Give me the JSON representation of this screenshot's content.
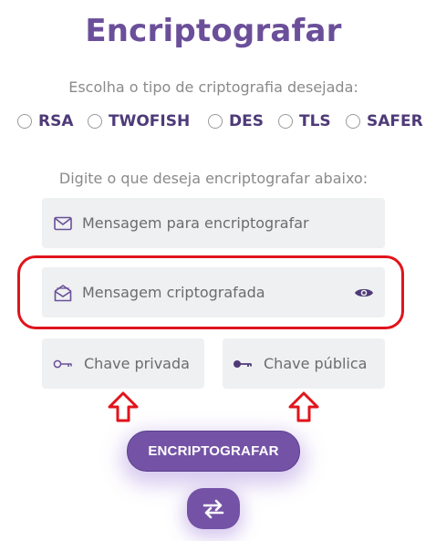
{
  "page": {
    "title": "Encriptografar",
    "type_prompt": "Escolha o tipo de criptografia desejada:",
    "input_prompt": "Digite o que deseja encriptografar abaixo:"
  },
  "crypto_types": [
    "RSA",
    "TWOFISH",
    "DES",
    "TLS",
    "SAFER"
  ],
  "fields": {
    "message": {
      "placeholder": "Mensagem para encriptografar",
      "icon": "envelope-icon"
    },
    "encrypted": {
      "placeholder": "Mensagem criptografada",
      "icon": "envelope-open-icon",
      "toggle_icon": "eye-icon"
    },
    "private_key": {
      "placeholder": "Chave privada",
      "icon": "key-outline-icon"
    },
    "public_key": {
      "placeholder": "Chave pública",
      "icon": "key-filled-icon"
    }
  },
  "buttons": {
    "encrypt": "ENCRIPTOGRAFAR",
    "swap_icon": "swap-arrows-icon"
  },
  "annotations": {
    "highlight_color": "#e0141c",
    "arrow_color": "#e0141c"
  },
  "colors": {
    "brand": "#6b4f9a",
    "button": "#7453a6",
    "field_bg": "#eef0f1"
  }
}
